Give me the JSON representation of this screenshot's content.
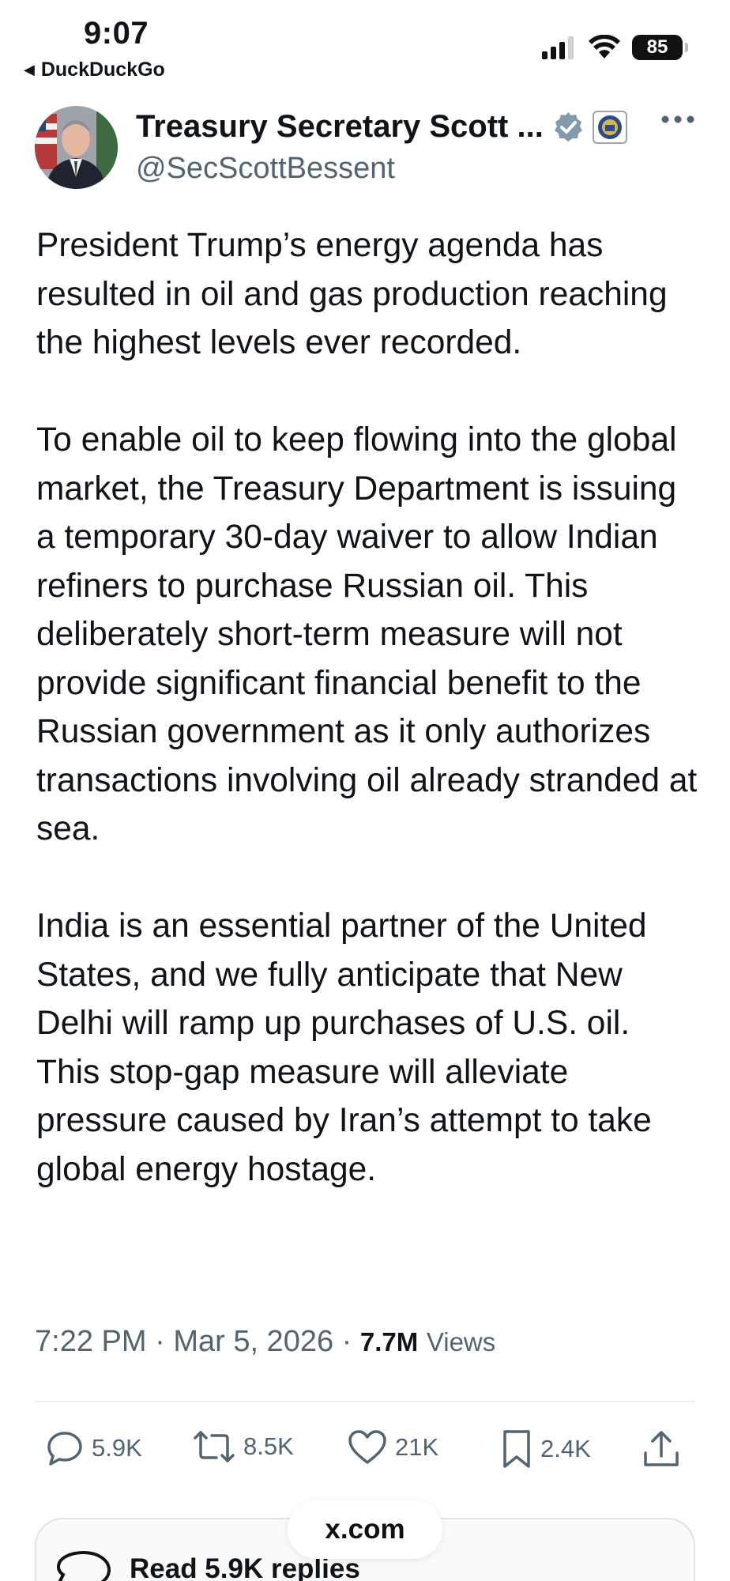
{
  "status_bar": {
    "time": "9:07",
    "back_app": "DuckDuckGo",
    "battery": "85",
    "icons": [
      "cellular-signal-icon",
      "wifi-icon",
      "battery-icon"
    ]
  },
  "author": {
    "display_name": "Treasury Secretary Scott ...",
    "handle": "@SecScottBessent",
    "verified_badge": "verified-badge-icon",
    "affiliation_badge": "treasury-seal-icon"
  },
  "tweet": {
    "paragraphs": [
      "President Trump’s energy agenda has resulted in oil and gas production reaching the highest levels ever recorded.",
      "To enable oil to keep flowing into the global market, the Treasury Department is issuing a temporary 30-day waiver to allow Indian refiners to purchase Russian oil. This deliberately short-term measure will not provide significant financial benefit to the Russian government as it only authorizes transactions involving oil already stranded at sea.",
      "India is an essential partner of the United States, and we fully anticipate that New Delhi will ramp up purchases of U.S. oil. This stop-gap measure will alleviate pressure caused by Iran’s attempt to take global energy hostage."
    ],
    "time": "7:22 PM",
    "date": "Mar 5, 2026",
    "views_count": "7.7M",
    "views_label": "Views"
  },
  "actions": {
    "replies": "5.9K",
    "reposts": "8.5K",
    "likes": "21K",
    "bookmarks": "2.4K"
  },
  "replies_card": {
    "label": "Read 5.9K replies"
  },
  "browser": {
    "url": "x.com"
  },
  "colors": {
    "text_primary": "#0f1419",
    "text_secondary": "#536471",
    "verified": "#829aab",
    "divider": "#eff3f4"
  }
}
